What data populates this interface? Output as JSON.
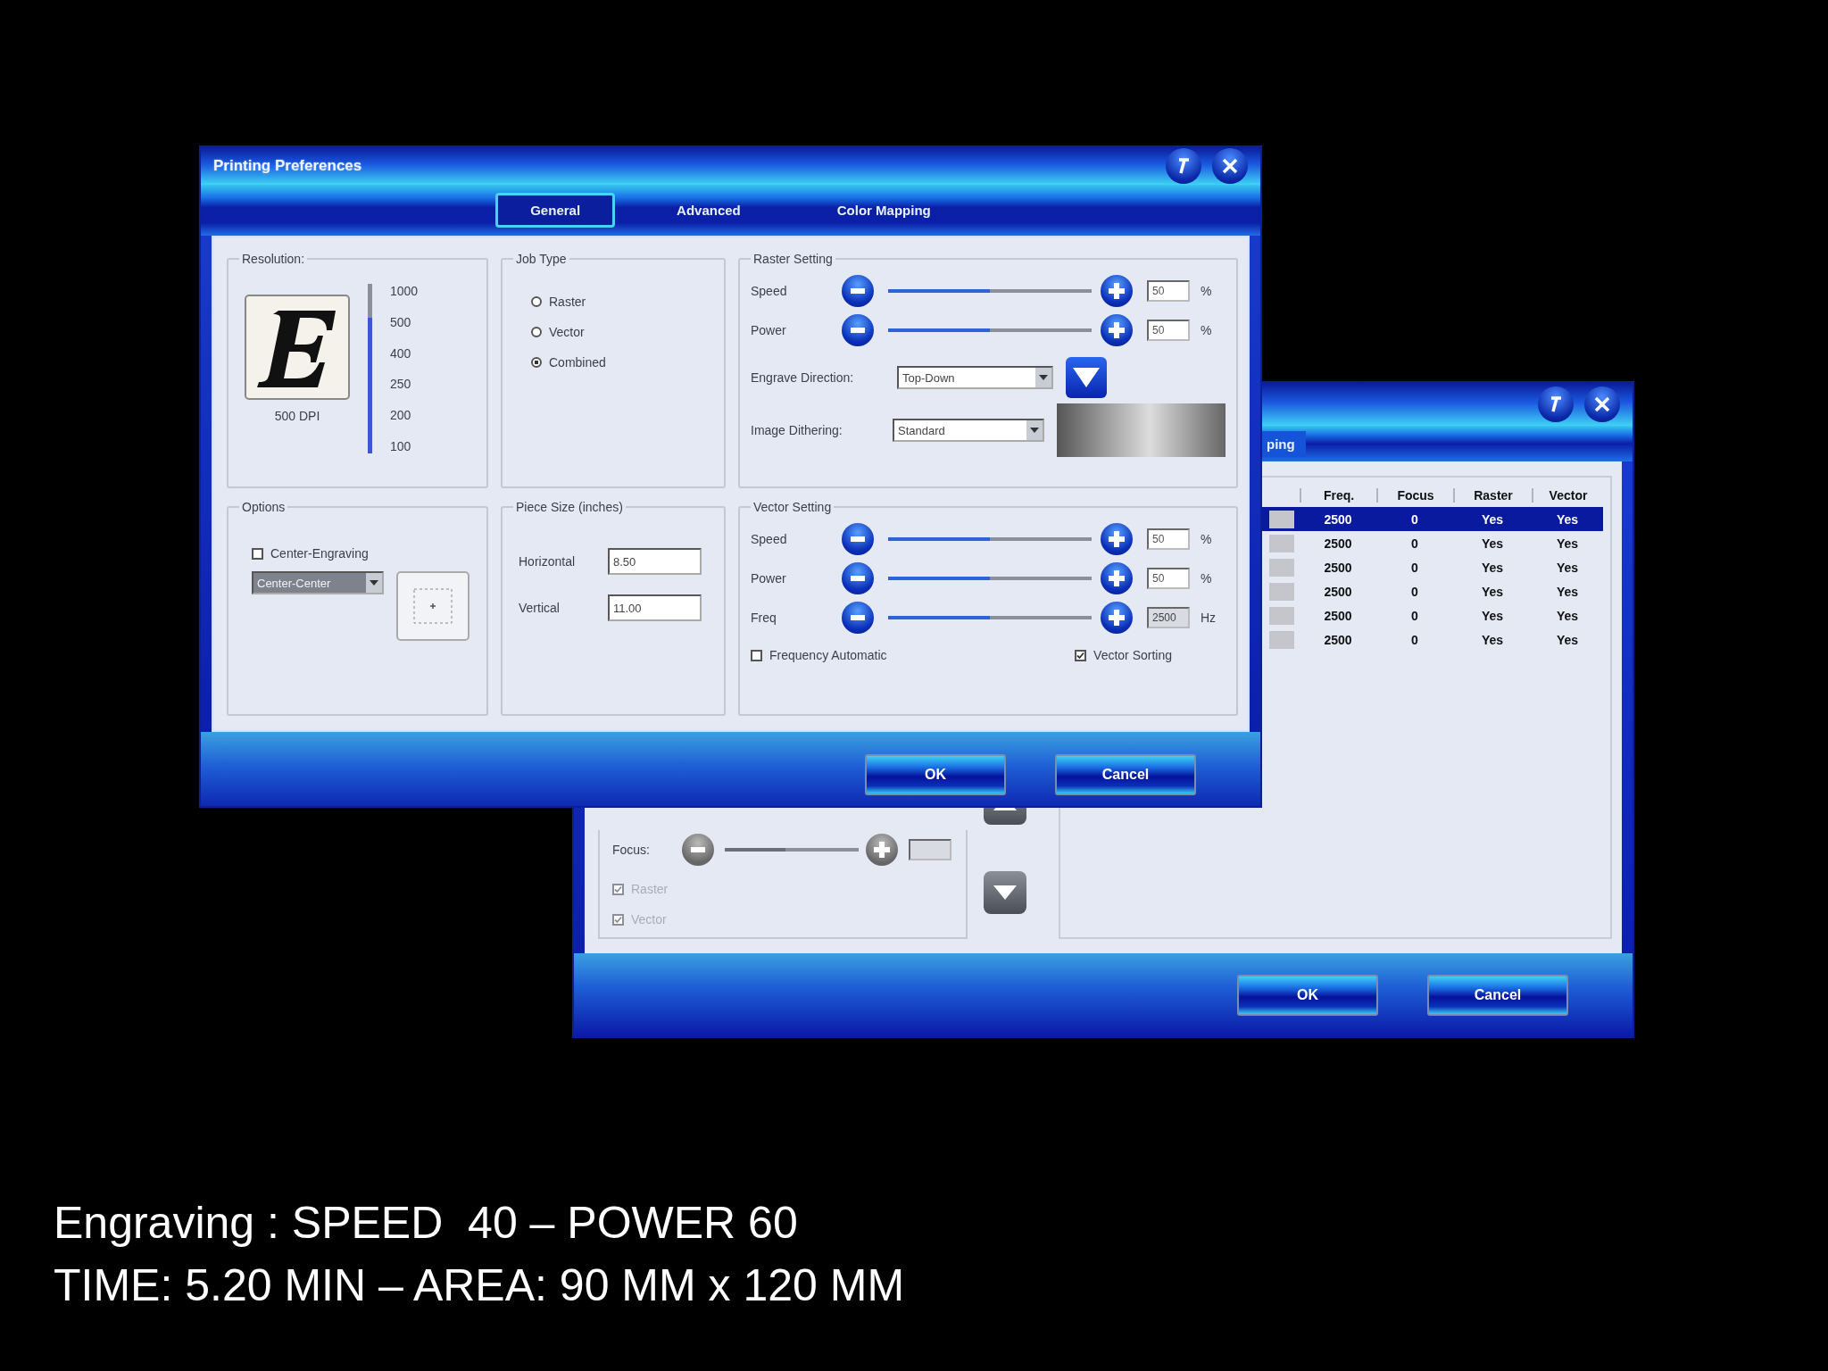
{
  "back_window": {
    "tab_fragment": "ping",
    "table": {
      "columns": [
        "Freq.",
        "Focus",
        "Raster",
        "Vector"
      ],
      "rows": [
        {
          "cells": [
            "2500",
            "0",
            "Yes",
            "Yes"
          ],
          "selected": true
        },
        {
          "cells": [
            "2500",
            "0",
            "Yes",
            "Yes"
          ],
          "selected": false
        },
        {
          "cells": [
            "2500",
            "0",
            "Yes",
            "Yes"
          ],
          "selected": false
        },
        {
          "cells": [
            "2500",
            "0",
            "Yes",
            "Yes"
          ],
          "selected": false
        },
        {
          "cells": [
            "2500",
            "0",
            "Yes",
            "Yes"
          ],
          "selected": false
        },
        {
          "cells": [
            "2500",
            "0",
            "Yes",
            "Yes"
          ],
          "selected": false
        }
      ]
    },
    "focus": {
      "label": "Focus:",
      "level": 0.45,
      "disabled": true
    },
    "checkboxes": [
      {
        "label": "Raster",
        "checked": true,
        "disabled": true
      },
      {
        "label": "Vector",
        "checked": true,
        "disabled": true
      }
    ],
    "buttons": [
      "OK",
      "Cancel"
    ]
  },
  "front_window": {
    "title": "Printing Preferences",
    "tabs": [
      {
        "label": "General",
        "selected": true
      },
      {
        "label": "Advanced",
        "selected": false
      },
      {
        "label": "Color Mapping",
        "selected": false
      }
    ],
    "resolution": {
      "legend": "Resolution:",
      "dpi": "500 DPI",
      "level": 0.8,
      "ticks": [
        "1000",
        "500",
        "400",
        "250",
        "200",
        "100"
      ]
    },
    "job_type": {
      "legend": "Job Type",
      "options": [
        {
          "label": "Raster",
          "selected": false
        },
        {
          "label": "Vector",
          "selected": false
        },
        {
          "label": "Combined",
          "selected": true
        }
      ]
    },
    "raster_setting": {
      "legend": "Raster Setting",
      "sliders": [
        {
          "label": "Speed",
          "level": 0.5,
          "value": "50",
          "unit": "%",
          "disabled": false
        },
        {
          "label": "Power",
          "level": 0.5,
          "value": "50",
          "unit": "%",
          "disabled": false
        }
      ],
      "engrave_direction": {
        "label": "Engrave Direction:",
        "value": "Top-Down"
      },
      "image_dithering": {
        "label": "Image Dithering:",
        "value": "Standard"
      }
    },
    "options": {
      "legend": "Options",
      "center_engraving": {
        "label": "Center-Engraving",
        "checked": false
      },
      "position": {
        "value": "Center-Center",
        "disabled": true
      }
    },
    "piece_size": {
      "legend": "Piece Size (inches)",
      "fields": [
        {
          "label": "Horizontal",
          "value": "8.50"
        },
        {
          "label": "Vertical",
          "value": "11.00"
        }
      ]
    },
    "vector_setting": {
      "legend": "Vector Setting",
      "sliders": [
        {
          "label": "Speed",
          "level": 0.5,
          "value": "50",
          "unit": "%",
          "disabled": false
        },
        {
          "label": "Power",
          "level": 0.5,
          "value": "50",
          "unit": "%",
          "disabled": false
        },
        {
          "label": "Freq",
          "level": 0.5,
          "value": "2500",
          "unit": "Hz",
          "disabled": true
        }
      ],
      "checkboxes": [
        {
          "label": "Frequency Automatic",
          "checked": false
        },
        {
          "label": "Vector Sorting",
          "checked": true
        }
      ]
    },
    "buttons": [
      "OK",
      "Cancel"
    ]
  },
  "caption": [
    "Engraving : SPEED  40 – POWER 60",
    "TIME: 5.20 MIN – AREA: 90 MM x 120 MM"
  ]
}
